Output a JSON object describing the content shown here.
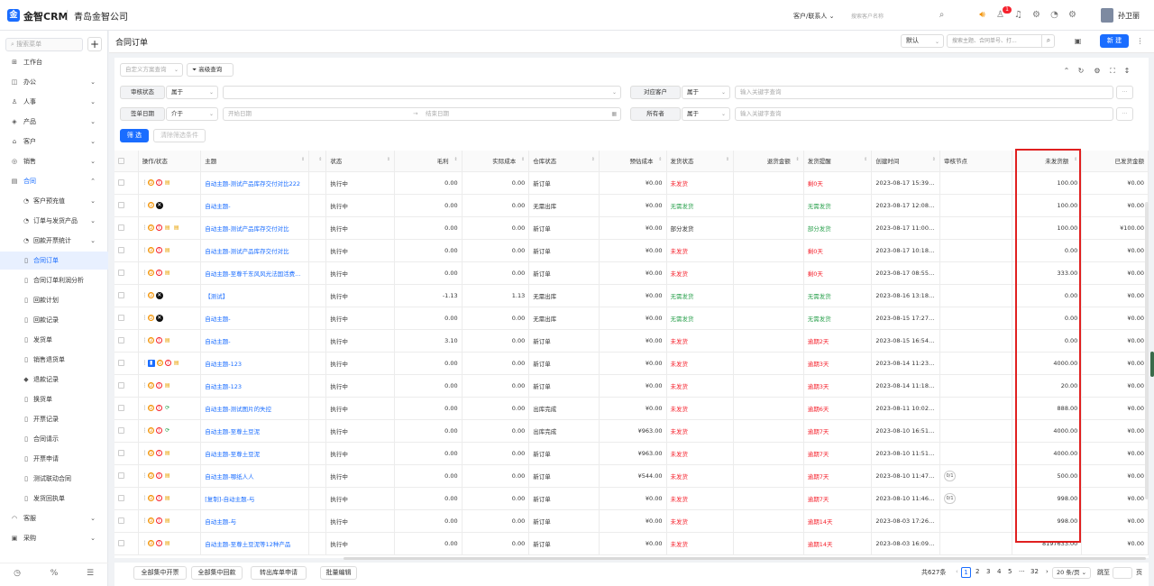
{
  "header": {
    "logo": "金",
    "brand": "金智CRM",
    "company": "青岛金智公司",
    "search_scope": "客户/联系人",
    "search_placeholder": "搜索客户名称",
    "notification_count": "1",
    "username": "孙卫丽"
  },
  "sidebar": {
    "search_placeholder": "搜索菜单",
    "add": "+",
    "items": [
      {
        "label": "工作台",
        "level": 1,
        "icon": "⊞",
        "chevron": ""
      },
      {
        "label": "办公",
        "level": 1,
        "icon": "◫",
        "chevron": "⌄"
      },
      {
        "label": "人事",
        "level": 1,
        "icon": "♙",
        "chevron": "⌄"
      },
      {
        "label": "产品",
        "level": 1,
        "icon": "◈",
        "chevron": "⌄"
      },
      {
        "label": "客户",
        "level": 1,
        "icon": "⌂",
        "chevron": "⌄"
      },
      {
        "label": "销售",
        "level": 1,
        "icon": "◎",
        "chevron": "⌄"
      },
      {
        "label": "合同",
        "level": 1,
        "icon": "▤",
        "chevron": "⌃",
        "active_text": true
      },
      {
        "label": "客户预充值",
        "level": 2,
        "icon": "◔",
        "chevron": "⌄"
      },
      {
        "label": "订单与发货产品",
        "level": 2,
        "icon": "◔",
        "chevron": "⌄"
      },
      {
        "label": "回款开票统计",
        "level": 2,
        "icon": "◔",
        "chevron": "⌄"
      },
      {
        "label": "合同订单",
        "level": 2,
        "icon": "▯",
        "chevron": "",
        "active": true
      },
      {
        "label": "合同订单利润分析",
        "level": 2,
        "icon": "▯",
        "chevron": ""
      },
      {
        "label": "回款计划",
        "level": 2,
        "icon": "▯",
        "chevron": ""
      },
      {
        "label": "回款记录",
        "level": 2,
        "icon": "▯",
        "chevron": ""
      },
      {
        "label": "发货单",
        "level": 2,
        "icon": "▯",
        "chevron": ""
      },
      {
        "label": "销售退货单",
        "level": 2,
        "icon": "▯",
        "chevron": ""
      },
      {
        "label": "退款记录",
        "level": 2,
        "icon": "◆",
        "chevron": ""
      },
      {
        "label": "换货单",
        "level": 2,
        "icon": "▯",
        "chevron": ""
      },
      {
        "label": "开票记录",
        "level": 2,
        "icon": "▯",
        "chevron": ""
      },
      {
        "label": "合同请示",
        "level": 2,
        "icon": "▯",
        "chevron": ""
      },
      {
        "label": "开票申请",
        "level": 2,
        "icon": "▯",
        "chevron": ""
      },
      {
        "label": "测试联动合同",
        "level": 2,
        "icon": "▯",
        "chevron": ""
      },
      {
        "label": "发货回执单",
        "level": 2,
        "icon": "▯",
        "chevron": ""
      },
      {
        "label": "客服",
        "level": 1,
        "icon": "◠",
        "chevron": "⌄"
      },
      {
        "label": "采购",
        "level": 1,
        "icon": "▣",
        "chevron": "⌄"
      }
    ]
  },
  "tabbar": {
    "title": "合同订单",
    "view_select": "默认",
    "search_placeholder": "搜索主题、合同单号、打...",
    "new_button": "新 建"
  },
  "filter": {
    "custom_scheme": "自定义方案查询",
    "advanced": "高级查询",
    "row1": {
      "field1": "审核状态",
      "op1": "属于",
      "field2": "对应客户",
      "op2": "属于",
      "placeholder2": "输入关键字查询"
    },
    "row2": {
      "field1": "签单日期",
      "op1": "介于",
      "start": "开始日期",
      "end": "结束日期",
      "field2": "所有者",
      "op2": "属于",
      "placeholder2": "输入关键字查询"
    },
    "search_btn": "筛 选",
    "clear_btn": "清除筛选条件",
    "more": "···"
  },
  "table": {
    "columns": [
      "操作/状态",
      "主题",
      "",
      "状态",
      "毛利",
      "实际成本",
      "仓库状态",
      "预估成本",
      "发货状态",
      "退货金额",
      "发货提醒",
      "创建时间",
      "审核节点",
      "未发货额",
      "已发货金额"
    ],
    "rows": [
      {
        "icons": [
          "o",
          "rr",
          "y"
        ],
        "subject": "自动主题-测试产品库存交付对比222",
        "status": "执行中",
        "profit": "0.00",
        "cost": "0.00",
        "wh": "新订单",
        "est": "¥0.00",
        "ship": "未发货",
        "shipc": "red",
        "ret": "",
        "remind": "剩0天",
        "remc": "red",
        "created": "2023-08-17 15:39:50",
        "node": "",
        "unshipped": "100.00",
        "shipped": "¥0.00"
      },
      {
        "icons": [
          "o",
          "b"
        ],
        "subject": "自动主题-",
        "status": "执行中",
        "profit": "0.00",
        "cost": "0.00",
        "wh": "无需出库",
        "est": "¥0.00",
        "ship": "无需发货",
        "shipc": "green",
        "ret": "",
        "remind": "无需发货",
        "remc": "green",
        "created": "2023-08-17 12:08:46",
        "node": "",
        "unshipped": "100.00",
        "shipped": "¥0.00"
      },
      {
        "icons": [
          "o",
          "rr",
          "y",
          "y"
        ],
        "subject": "自动主题-测试产品库存交付对比",
        "status": "执行中",
        "profit": "0.00",
        "cost": "0.00",
        "wh": "新订单",
        "est": "¥0.00",
        "ship": "部分发货",
        "shipc": "",
        "ret": "",
        "remind": "部分发货",
        "remc": "green",
        "created": "2023-08-17 11:00:09",
        "node": "",
        "unshipped": "100.00",
        "shipped": "¥100.00"
      },
      {
        "icons": [
          "o",
          "rr",
          "y"
        ],
        "subject": "自动主题-测试产品库存交付对比",
        "status": "执行中",
        "profit": "0.00",
        "cost": "0.00",
        "wh": "新订单",
        "est": "¥0.00",
        "ship": "未发货",
        "shipc": "red",
        "ret": "",
        "remind": "剩0天",
        "remc": "red",
        "created": "2023-08-17 10:18:37",
        "node": "",
        "unshipped": "0.00",
        "shipped": "¥0.00"
      },
      {
        "icons": [
          "o",
          "rr",
          "y"
        ],
        "subject": "自动主题-至尊千东风风光法国活费...",
        "status": "执行中",
        "profit": "0.00",
        "cost": "0.00",
        "wh": "新订单",
        "est": "¥0.00",
        "ship": "未发货",
        "shipc": "red",
        "ret": "",
        "remind": "剩0天",
        "remc": "red",
        "created": "2023-08-17 08:55:50",
        "node": "",
        "unshipped": "333.00",
        "shipped": "¥0.00"
      },
      {
        "icons": [
          "o",
          "b"
        ],
        "subject": "【测试】",
        "status": "执行中",
        "profit": "-1.13",
        "cost": "1.13",
        "wh": "无需出库",
        "est": "¥0.00",
        "ship": "无需发货",
        "shipc": "green",
        "ret": "",
        "remind": "无需发货",
        "remc": "green",
        "created": "2023-08-16 13:18:42",
        "node": "",
        "unshipped": "0.00",
        "shipped": "¥0.00"
      },
      {
        "icons": [
          "o",
          "b"
        ],
        "subject": "自动主题-",
        "status": "执行中",
        "profit": "0.00",
        "cost": "0.00",
        "wh": "无需出库",
        "est": "¥0.00",
        "ship": "无需发货",
        "shipc": "green",
        "ret": "",
        "remind": "无需发货",
        "remc": "green",
        "created": "2023-08-15 17:27:58",
        "node": "",
        "unshipped": "0.00",
        "shipped": "¥0.00"
      },
      {
        "icons": [
          "o",
          "rr",
          "y"
        ],
        "subject": "自动主题-",
        "status": "执行中",
        "profit": "3.10",
        "cost": "0.00",
        "wh": "新订单",
        "est": "¥0.00",
        "ship": "未发货",
        "shipc": "red",
        "ret": "",
        "remind": "逾期2天",
        "remc": "red",
        "created": "2023-08-15 16:54:47",
        "node": "",
        "unshipped": "0.00",
        "shipped": "¥0.00"
      },
      {
        "icons": [
          "bl",
          "o",
          "rr",
          "y"
        ],
        "subject": "自动主题-123",
        "status": "执行中",
        "profit": "0.00",
        "cost": "0.00",
        "wh": "新订单",
        "est": "¥0.00",
        "ship": "未发货",
        "shipc": "red",
        "ret": "",
        "remind": "逾期3天",
        "remc": "red",
        "created": "2023-08-14 11:23:27",
        "node": "",
        "unshipped": "4000.00",
        "shipped": "¥0.00"
      },
      {
        "icons": [
          "o",
          "rr",
          "y"
        ],
        "subject": "自动主题-123",
        "status": "执行中",
        "profit": "0.00",
        "cost": "0.00",
        "wh": "新订单",
        "est": "¥0.00",
        "ship": "未发货",
        "shipc": "red",
        "ret": "",
        "remind": "逾期3天",
        "remc": "red",
        "created": "2023-08-14 11:18:18",
        "node": "",
        "unshipped": "20.00",
        "shipped": "¥0.00"
      },
      {
        "icons": [
          "o",
          "rr",
          "g"
        ],
        "subject": "自动主题-测试图片的失控",
        "status": "执行中",
        "profit": "0.00",
        "cost": "0.00",
        "wh": "出库完成",
        "est": "¥0.00",
        "ship": "未发货",
        "shipc": "red",
        "ret": "",
        "remind": "逾期6天",
        "remc": "red",
        "created": "2023-08-11 10:02:49",
        "node": "",
        "unshipped": "888.00",
        "shipped": "¥0.00"
      },
      {
        "icons": [
          "o",
          "rr",
          "g"
        ],
        "subject": "自动主题-至尊土豆泥",
        "status": "执行中",
        "profit": "0.00",
        "cost": "0.00",
        "wh": "出库完成",
        "est": "¥963.00",
        "ship": "未发货",
        "shipc": "red",
        "ret": "",
        "remind": "逾期7天",
        "remc": "red",
        "created": "2023-08-10 16:51:33",
        "node": "",
        "unshipped": "4000.00",
        "shipped": "¥0.00"
      },
      {
        "icons": [
          "o",
          "rr",
          "y"
        ],
        "subject": "自动主题-至尊土豆泥",
        "status": "执行中",
        "profit": "0.00",
        "cost": "0.00",
        "wh": "新订单",
        "est": "¥963.00",
        "ship": "未发货",
        "shipc": "red",
        "ret": "",
        "remind": "逾期7天",
        "remc": "red",
        "created": "2023-08-10 11:51:55",
        "node": "",
        "unshipped": "4000.00",
        "shipped": "¥0.00"
      },
      {
        "icons": [
          "o",
          "rr",
          "y"
        ],
        "subject": "自动主题-哪纸人人",
        "status": "执行中",
        "profit": "0.00",
        "cost": "0.00",
        "wh": "新订单",
        "est": "¥544.00",
        "ship": "未发货",
        "shipc": "red",
        "ret": "",
        "remind": "逾期7天",
        "remc": "red",
        "created": "2023-08-10 11:47:34",
        "node": "0/1",
        "unshipped": "500.00",
        "shipped": "¥0.00"
      },
      {
        "icons": [
          "o",
          "rr",
          "y"
        ],
        "subject": "[复制]-自动主题-与",
        "status": "执行中",
        "profit": "0.00",
        "cost": "0.00",
        "wh": "新订单",
        "est": "¥0.00",
        "ship": "未发货",
        "shipc": "red",
        "ret": "",
        "remind": "逾期7天",
        "remc": "red",
        "created": "2023-08-10 11:46:31",
        "node": "0/1",
        "unshipped": "998.00",
        "shipped": "¥0.00"
      },
      {
        "icons": [
          "o",
          "rr",
          "y"
        ],
        "subject": "自动主题-与",
        "status": "执行中",
        "profit": "0.00",
        "cost": "0.00",
        "wh": "新订单",
        "est": "¥0.00",
        "ship": "未发货",
        "shipc": "red",
        "ret": "",
        "remind": "逾期14天",
        "remc": "red",
        "created": "2023-08-03 17:26:31",
        "node": "",
        "unshipped": "998.00",
        "shipped": "¥0.00"
      },
      {
        "icons": [
          "o",
          "rr",
          "y"
        ],
        "subject": "自动主题-至尊土豆泥等12种产品",
        "status": "执行中",
        "profit": "0.00",
        "cost": "0.00",
        "wh": "新订单",
        "est": "¥0.00",
        "ship": "未发货",
        "shipc": "red",
        "ret": "",
        "remind": "逾期14天",
        "remc": "red",
        "created": "2023-08-03 16:09:18",
        "node": "",
        "unshipped": "8197633.00",
        "shipped": "¥0.00"
      }
    ]
  },
  "footer": {
    "buttons": [
      "全部集中开票",
      "全部集中回款",
      "转出库单申请",
      "批量编辑"
    ],
    "total": "共627条",
    "pages": [
      "1",
      "2",
      "3",
      "4",
      "5",
      "···",
      "32"
    ],
    "page_size": "20 条/页",
    "goto": "跳至",
    "page_unit": "页",
    "prev": "‹",
    "next": "›"
  },
  "colors": {
    "accent": "#1a6dff",
    "danger": "#f5222d",
    "success": "#2ba14e",
    "highlight_box": "#e02020"
  }
}
